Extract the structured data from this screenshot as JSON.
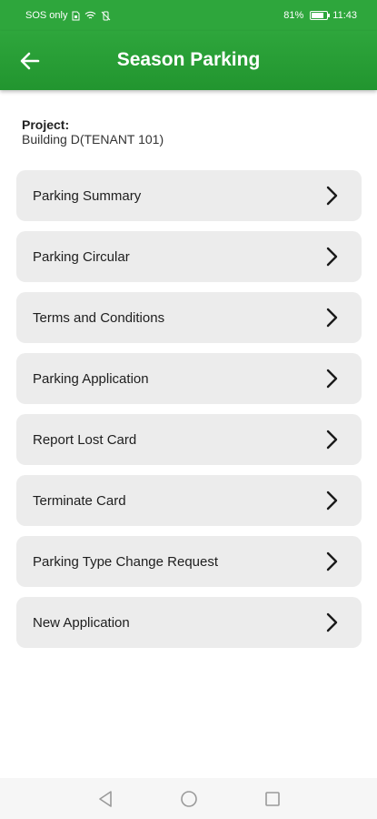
{
  "status_bar": {
    "carrier": "SOS only",
    "battery_percent": "81%",
    "battery_level": 0.81,
    "time": "11:43"
  },
  "app_bar": {
    "title": "Season Parking",
    "back_icon": "arrow-left-icon",
    "color": "#2ea63c"
  },
  "project": {
    "label": "Project:",
    "value": "Building D(TENANT 101)"
  },
  "menu": {
    "items": [
      {
        "label": "Parking Summary"
      },
      {
        "label": "Parking Circular"
      },
      {
        "label": "Terms and Conditions"
      },
      {
        "label": "Parking Application"
      },
      {
        "label": "Report Lost Card"
      },
      {
        "label": "Terminate Card"
      },
      {
        "label": "Parking Type Change Request"
      },
      {
        "label": "New Application"
      }
    ],
    "item_icon": "chevron-right-icon"
  },
  "nav_bar": {
    "buttons": [
      "back-triangle-icon",
      "home-circle-icon",
      "recents-square-icon"
    ]
  }
}
